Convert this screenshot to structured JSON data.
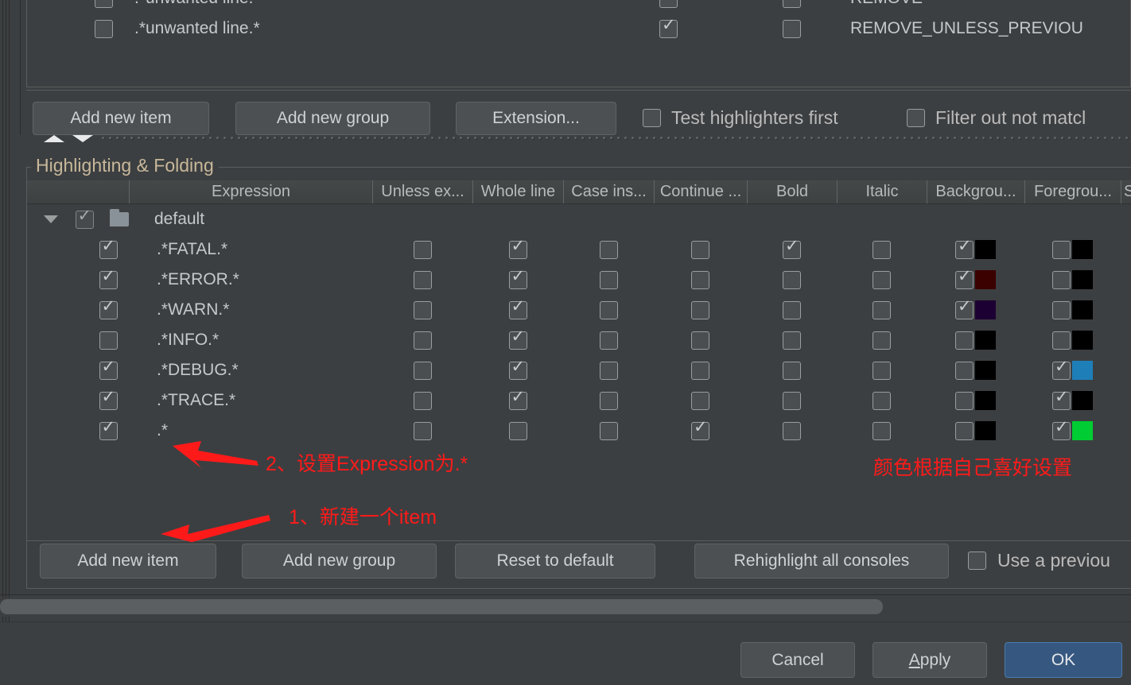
{
  "upper_table": {
    "rows": [
      {
        "enabled": false,
        "expression": ".*unwanted line.*",
        "col_a": true,
        "col_b": false,
        "action": "REMOVE"
      },
      {
        "enabled": false,
        "expression": ".*unwanted line.*",
        "col_a": true,
        "col_b": false,
        "action": "REMOVE_UNLESS_PREVIOU"
      }
    ]
  },
  "upper_toolbar": {
    "add_new_item": "Add new item",
    "add_new_group": "Add new group",
    "extension": "Extension...",
    "test_highlighters_first": "Test highlighters first",
    "test_highlighters_first_checked": false,
    "filter_out_not_matching": "Filter out not matcl",
    "filter_out_not_matching_checked": false
  },
  "group": {
    "title": "Highlighting & Folding",
    "columns": [
      {
        "label": "",
        "key": "check"
      },
      {
        "label": "Expression",
        "key": "expression"
      },
      {
        "label": "Unless ex...",
        "key": "unless_expression"
      },
      {
        "label": "Whole line",
        "key": "whole_line"
      },
      {
        "label": "Case ins...",
        "key": "case_insensitive"
      },
      {
        "label": "Continue ...",
        "key": "continue_matching"
      },
      {
        "label": "Bold",
        "key": "bold"
      },
      {
        "label": "Italic",
        "key": "italic"
      },
      {
        "label": "Backgrou...",
        "key": "background"
      },
      {
        "label": "Foregrou...",
        "key": "foreground"
      },
      {
        "label": "St",
        "key": "stripe"
      }
    ],
    "tree_root": {
      "expanded": true,
      "checked": true,
      "label": "default",
      "icon": "folder-icon"
    },
    "rows": [
      {
        "enabled": true,
        "expression": ".*FATAL.*",
        "unless_expression": false,
        "whole_line": true,
        "case_insensitive": false,
        "continue_matching": false,
        "bold": true,
        "italic": false,
        "background_checked": true,
        "background_color": "#000000",
        "foreground_checked": false,
        "foreground_color": "#000000"
      },
      {
        "enabled": true,
        "expression": ".*ERROR.*",
        "unless_expression": false,
        "whole_line": true,
        "case_insensitive": false,
        "continue_matching": false,
        "bold": false,
        "italic": false,
        "background_checked": true,
        "background_color": "#3b0000",
        "foreground_checked": false,
        "foreground_color": "#000000"
      },
      {
        "enabled": true,
        "expression": ".*WARN.*",
        "unless_expression": false,
        "whole_line": true,
        "case_insensitive": false,
        "continue_matching": false,
        "bold": false,
        "italic": false,
        "background_checked": true,
        "background_color": "#1d0033",
        "foreground_checked": false,
        "foreground_color": "#000000"
      },
      {
        "enabled": false,
        "expression": ".*INFO.*",
        "unless_expression": false,
        "whole_line": true,
        "case_insensitive": false,
        "continue_matching": false,
        "bold": false,
        "italic": false,
        "background_checked": false,
        "background_color": "#000000",
        "foreground_checked": false,
        "foreground_color": "#000000"
      },
      {
        "enabled": true,
        "expression": ".*DEBUG.*",
        "unless_expression": false,
        "whole_line": true,
        "case_insensitive": false,
        "continue_matching": false,
        "bold": false,
        "italic": false,
        "background_checked": false,
        "background_color": "#000000",
        "foreground_checked": true,
        "foreground_color": "#1e7fb8"
      },
      {
        "enabled": true,
        "expression": ".*TRACE.*",
        "unless_expression": false,
        "whole_line": true,
        "case_insensitive": false,
        "continue_matching": false,
        "bold": false,
        "italic": false,
        "background_checked": false,
        "background_color": "#000000",
        "foreground_checked": true,
        "foreground_color": "#000000"
      },
      {
        "enabled": true,
        "expression": ".*",
        "unless_expression": false,
        "whole_line": false,
        "case_insensitive": false,
        "continue_matching": true,
        "bold": false,
        "italic": false,
        "background_checked": false,
        "background_color": "#000000",
        "foreground_checked": true,
        "foreground_color": "#00cc33"
      }
    ],
    "toolbar": {
      "add_new_item": "Add new item",
      "add_new_group": "Add new group",
      "reset_to_default": "Reset to default",
      "rehighlight_all_consoles": "Rehighlight all consoles",
      "use_a_previous": "Use a previou",
      "use_a_previous_checked": false
    }
  },
  "annotations": {
    "note_expression": "2、设置Expression为.*",
    "note_new_item": "1、新建一个item",
    "note_color": "颜色根据自己喜好设置",
    "color": "#ff1a1a"
  },
  "dialog_buttons": {
    "cancel": "Cancel",
    "apply_prefix": "",
    "apply_mnemonic": "A",
    "apply_rest": "pply",
    "ok": "OK"
  }
}
